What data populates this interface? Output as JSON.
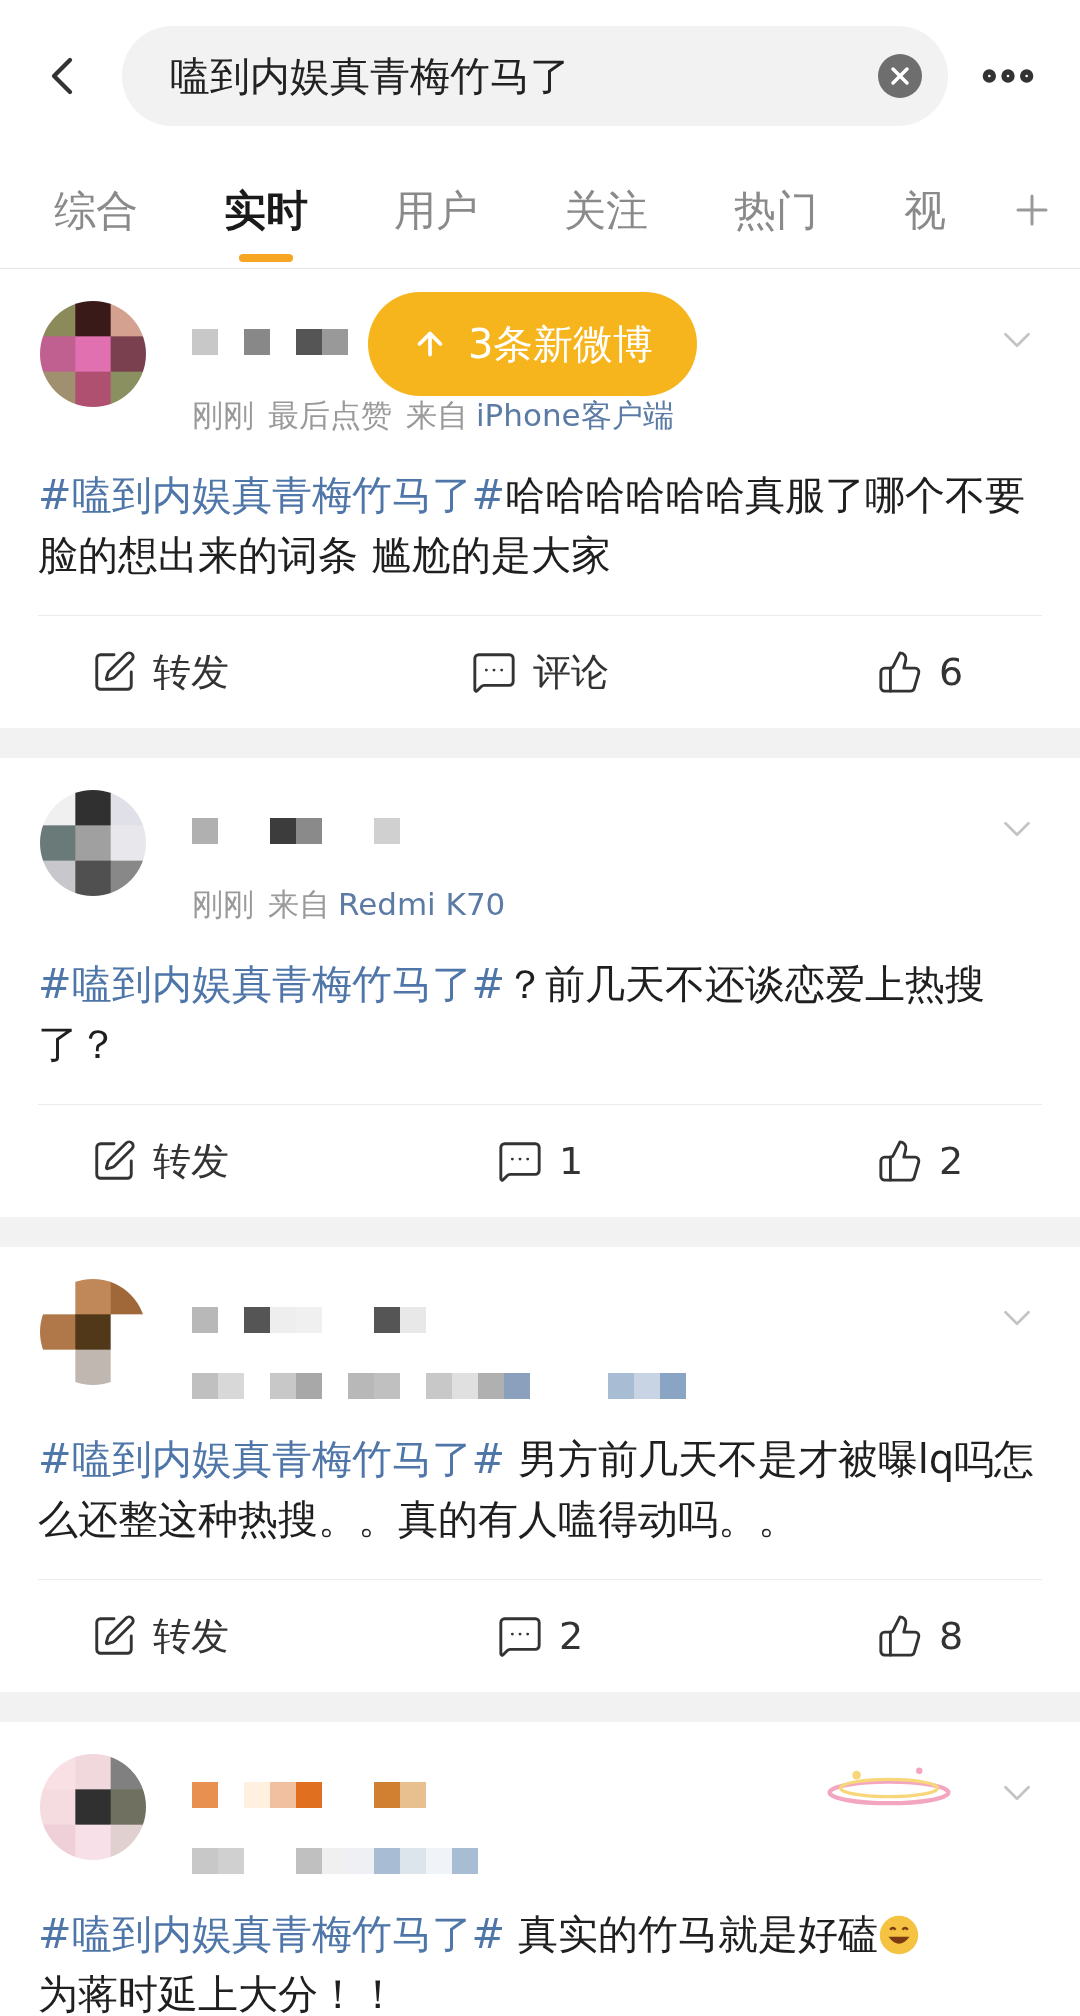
{
  "search": {
    "value": "嗑到内娱真青梅竹马了"
  },
  "tabs": [
    {
      "label": "综合",
      "selected": false
    },
    {
      "label": "实时",
      "selected": true
    },
    {
      "label": "用户",
      "selected": false
    },
    {
      "label": "关注",
      "selected": false
    },
    {
      "label": "热门",
      "selected": false
    },
    {
      "label": "视",
      "selected": false
    }
  ],
  "new_posts_toast": "3条新微博",
  "posts": [
    {
      "meta": {
        "time": "刚刚",
        "note": "最后点赞",
        "source_prefix": "来自",
        "source": "iPhone客户端"
      },
      "hashtag": "#嗑到内娱真青梅竹马了#",
      "text": "哈哈哈哈哈哈真服了哪个不要脸的想出来的词条 尴尬的是大家",
      "actions": {
        "repost": "转发",
        "comment": "评论",
        "like": "6"
      }
    },
    {
      "meta": {
        "time": "刚刚",
        "source_prefix": "来自",
        "source": "Redmi K70"
      },
      "hashtag": "#嗑到内娱真青梅竹马了#",
      "text": "？前几天不还谈恋爱上热搜了？",
      "actions": {
        "repost": "转发",
        "comment": "1",
        "like": "2"
      }
    },
    {
      "hashtag": "#嗑到内娱真青梅竹马了#",
      "text": " 男方前几天不是才被曝lq吗怎么还整这种热搜。。真的有人嗑得动吗。。",
      "actions": {
        "repost": "转发",
        "comment": "2",
        "like": "8"
      }
    },
    {
      "hashtag": "#嗑到内娱真青梅竹马了#",
      "text": "  真实的竹马就是好磕",
      "emoji": true,
      "text_after": "为蒋时延上大分！！"
    }
  ]
}
